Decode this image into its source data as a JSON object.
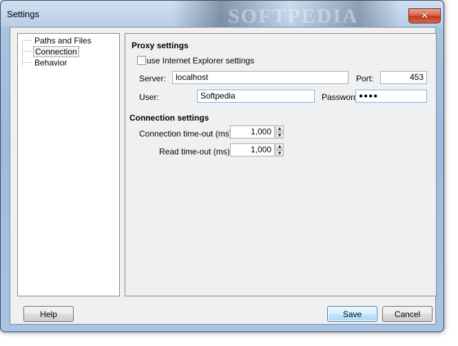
{
  "window": {
    "title": "Settings",
    "watermark": "SOFTPEDIA",
    "close_label": "✕"
  },
  "tree": {
    "items": [
      {
        "label": "Paths and Files",
        "selected": false
      },
      {
        "label": "Connection",
        "selected": true
      },
      {
        "label": "Behavior",
        "selected": false
      }
    ]
  },
  "proxy": {
    "heading": "Proxy settings",
    "use_ie_label": "use Internet Explorer settings",
    "use_ie_checked": false,
    "server_label": "Server:",
    "server_value": "localhost",
    "port_label": "Port:",
    "port_value": "453",
    "user_label": "User:",
    "user_value": "Softpedia",
    "password_label": "Password:",
    "password_value": "●●●●"
  },
  "connection": {
    "heading": "Connection settings",
    "conn_timeout_label": "Connection time-out (ms):",
    "conn_timeout_value": "1,000",
    "read_timeout_label": "Read time-out (ms):",
    "read_timeout_value": "1,000"
  },
  "buttons": {
    "help": "Help",
    "save": "Save",
    "cancel": "Cancel"
  },
  "icons": {
    "spin_up": "▲",
    "spin_down": "▼"
  }
}
